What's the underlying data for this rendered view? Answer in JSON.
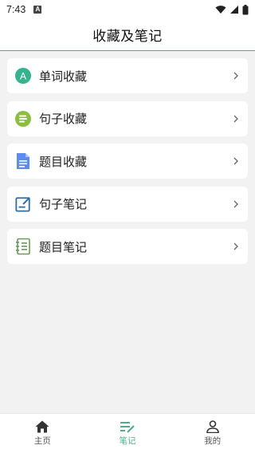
{
  "status_bar": {
    "time": "7:43",
    "notification_glyph": "A"
  },
  "header": {
    "title": "收藏及笔记"
  },
  "items": [
    {
      "label": "单词收藏",
      "icon": "letter-a-circle-icon",
      "icon_letter": "A",
      "icon_color": "#35b38f"
    },
    {
      "label": "句子收藏",
      "icon": "list-circle-icon",
      "icon_color": "#8bbf3f"
    },
    {
      "label": "题目收藏",
      "icon": "document-icon",
      "icon_color": "#5b8def"
    },
    {
      "label": "句子笔记",
      "icon": "edit-note-icon",
      "icon_color": "#2f6da8"
    },
    {
      "label": "题目笔记",
      "icon": "notebook-icon",
      "icon_color": "#6a9a5a"
    }
  ],
  "tabbar": {
    "tabs": [
      {
        "label": "主页",
        "icon": "home-icon",
        "active": false
      },
      {
        "label": "笔记",
        "icon": "note-edit-icon",
        "active": true
      },
      {
        "label": "我的",
        "icon": "profile-icon",
        "active": false
      }
    ],
    "active_color": "#4caf8a"
  }
}
